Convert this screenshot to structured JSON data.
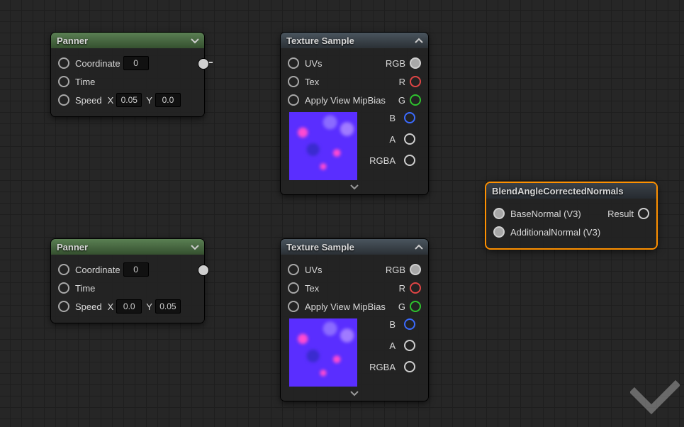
{
  "nodes": {
    "panner1": {
      "title": "Panner",
      "coord_label": "Coordinate",
      "coord_val": "0",
      "time_label": "Time",
      "speed_label": "Speed",
      "speed_x_prefix": "X",
      "speed_x": "0.05",
      "speed_y_prefix": "Y",
      "speed_y": "0.0"
    },
    "panner2": {
      "title": "Panner",
      "coord_label": "Coordinate",
      "coord_val": "0",
      "time_label": "Time",
      "speed_label": "Speed",
      "speed_x_prefix": "X",
      "speed_x": "0.0",
      "speed_y_prefix": "Y",
      "speed_y": "0.05"
    },
    "tex1": {
      "title": "Texture Sample",
      "uvs": "UVs",
      "tex": "Tex",
      "mip": "Apply View MipBias",
      "rgb": "RGB",
      "r": "R",
      "g": "G",
      "b": "B",
      "a": "A",
      "rgba": "RGBA"
    },
    "tex2": {
      "title": "Texture Sample",
      "uvs": "UVs",
      "tex": "Tex",
      "mip": "Apply View MipBias",
      "rgb": "RGB",
      "r": "R",
      "g": "G",
      "b": "B",
      "a": "A",
      "rgba": "RGBA"
    },
    "blend": {
      "title": "BlendAngleCorrectedNormals",
      "base": "BaseNormal (V3)",
      "add": "AdditionalNormal (V3)",
      "result": "Result"
    }
  }
}
